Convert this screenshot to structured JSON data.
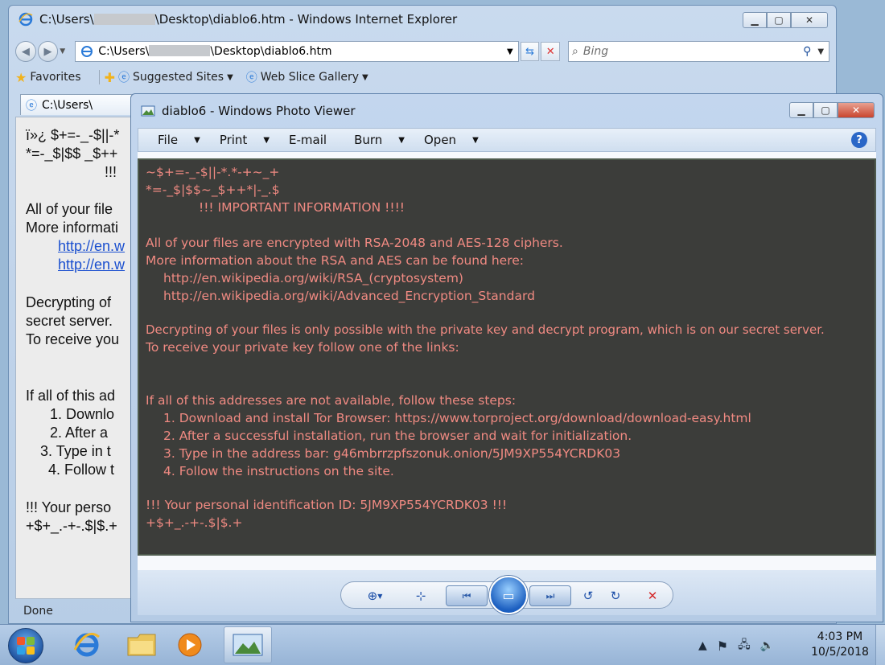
{
  "ie": {
    "title_prefix": "C:\\Users\\",
    "title_suffix": "\\Desktop\\diablo6.htm - Windows Internet Explorer",
    "address_prefix": "C:\\Users\\",
    "address_suffix": "\\Desktop\\diablo6.htm",
    "search_placeholder": "Bing",
    "favorites_label": "Favorites",
    "suggested_sites_label": "Suggested Sites",
    "web_slice_label": "Web Slice Gallery",
    "tab_label": "C:\\Users\\",
    "status": "Done",
    "content": {
      "l1": "ï»¿ $+=-_-$||-*",
      "l2": "*=-_$|$$ _$++",
      "l3": "!!!",
      "l4": "All of your file",
      "l5": "More informati",
      "l6": "http://en.w",
      "l7": "http://en.w",
      "l8": "Decrypting of",
      "l9": "secret server.",
      "l10": "To receive you",
      "l11": "If all of this ad",
      "l12": "1. Downlo",
      "l13": "2. After a",
      "l14": "3. Type in t",
      "l15": "4. Follow t",
      "l16": "!!! Your perso",
      "l17": "+$+_.-+-.$|$.+"
    }
  },
  "viewer": {
    "title": "diablo6 - Windows Photo Viewer",
    "menu": {
      "file": "File",
      "print": "Print",
      "email": "E-mail",
      "burn": "Burn",
      "open": "Open"
    },
    "note": {
      "l1": "~$+=-_-$||-*.*-+~_+",
      "l2": "*=-_$|$$~_$++*|-_.$",
      "l3": "!!! IMPORTANT INFORMATION !!!!",
      "l4": "All of your files are encrypted with RSA-2048 and AES-128 ciphers.",
      "l5": "More information about the RSA and AES can be found here:",
      "l6": "http://en.wikipedia.org/wiki/RSA_(cryptosystem)",
      "l7": "http://en.wikipedia.org/wiki/Advanced_Encryption_Standard",
      "l8": "Decrypting of your files is only possible with the private key and decrypt program, which is on our secret server.",
      "l9": "To receive your private key follow one of the links:",
      "l10": "If all of this addresses are not available, follow these steps:",
      "l11": "1. Download and install Tor Browser: https://www.torproject.org/download/download-easy.html",
      "l12": "2. After a successful installation, run the browser and wait for initialization.",
      "l13": "3. Type in the address bar: g46mbrrzpfszonuk.onion/5JM9XP554YCRDK03",
      "l14": "4. Follow the instructions on the site.",
      "l15": "!!! Your personal identification ID: 5JM9XP554YCRDK03 !!!",
      "l16": "+$+_.-+-.$|$.+"
    },
    "note_color": "#f08a82",
    "photo_bg": "#3c3d3a"
  },
  "taskbar": {
    "time": "4:03 PM",
    "date": "10/5/2018"
  }
}
